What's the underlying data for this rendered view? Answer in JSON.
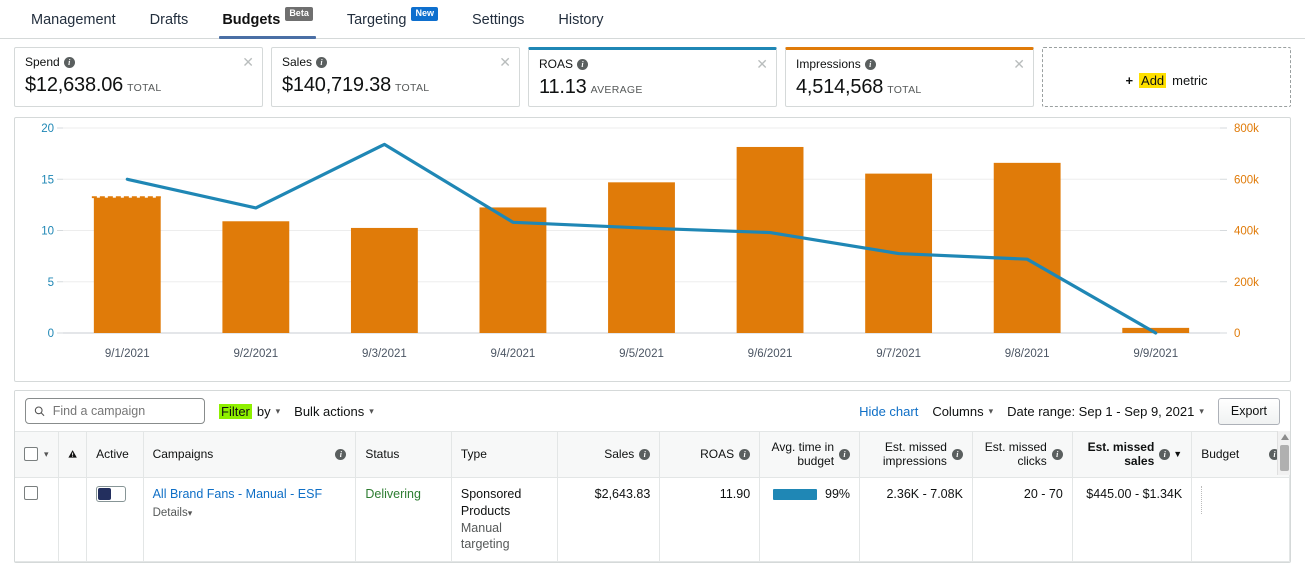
{
  "nav": {
    "tabs": [
      {
        "label": "Management",
        "active": false,
        "badge": null
      },
      {
        "label": "Drafts",
        "active": false,
        "badge": null
      },
      {
        "label": "Budgets",
        "active": true,
        "badge": "Beta",
        "badge_type": "beta"
      },
      {
        "label": "Targeting",
        "active": false,
        "badge": "New",
        "badge_type": "new"
      },
      {
        "label": "Settings",
        "active": false,
        "badge": null
      },
      {
        "label": "History",
        "active": false,
        "badge": null
      }
    ]
  },
  "metric_cards": [
    {
      "title": "Spend",
      "value": "$12,638.06",
      "unit": "TOTAL",
      "accent": "#ffffff",
      "closable": true
    },
    {
      "title": "Sales",
      "value": "$140,719.38",
      "unit": "TOTAL",
      "accent": "#ffffff",
      "closable": true
    },
    {
      "title": "ROAS",
      "value": "11.13",
      "unit": "AVERAGE",
      "accent": "#1f87b5",
      "closable": true
    },
    {
      "title": "Impressions",
      "value": "4,514,568",
      "unit": "TOTAL",
      "accent": "#e07b09",
      "closable": true
    }
  ],
  "add_metric": {
    "plus": "+",
    "highlight": "Add",
    "rest": "metric"
  },
  "chart_data": {
    "type": "bar",
    "title": "",
    "categories": [
      "9/1/2021",
      "9/2/2021",
      "9/3/2021",
      "9/4/2021",
      "9/5/2021",
      "9/6/2021",
      "9/7/2021",
      "9/8/2021",
      "9/9/2021"
    ],
    "series": [
      {
        "name": "Impressions",
        "type": "bar",
        "axis": "right",
        "color": "#e07b09",
        "values": [
          528000,
          436000,
          410000,
          490000,
          588000,
          726000,
          622000,
          664000,
          20000
        ]
      },
      {
        "name": "ROAS",
        "type": "line",
        "axis": "left",
        "color": "#1f87b5",
        "values": [
          15.0,
          12.2,
          18.4,
          10.8,
          10.25,
          9.8,
          7.75,
          7.2,
          0
        ]
      }
    ],
    "budget_cap_marker": {
      "category": "9/1/2021",
      "value": 530000,
      "color": "#e07b09",
      "style": "dashed"
    },
    "left_axis": {
      "label": "",
      "ticks": [
        0,
        5,
        10,
        15,
        20
      ],
      "tick_labels": [
        "0",
        "5",
        "10",
        "15",
        "20"
      ],
      "min": 0,
      "max": 20,
      "color": "#1f87b5"
    },
    "right_axis": {
      "label": "",
      "ticks": [
        0,
        200000,
        400000,
        600000,
        800000
      ],
      "tick_labels": [
        "0",
        "200k",
        "400k",
        "600k",
        "800k"
      ],
      "min": 0,
      "max": 800000,
      "color": "#e07b09"
    },
    "grid": true,
    "legend": "none",
    "xlabel": "",
    "ylabel": ""
  },
  "toolbar": {
    "search_placeholder": "Find a campaign",
    "search_value": "",
    "filter_highlight": "Filter",
    "filter_rest": "by",
    "bulk_actions": "Bulk actions",
    "hide_chart": "Hide chart",
    "columns": "Columns",
    "date_range": "Date range: Sep 1 - Sep 9, 2021",
    "export": "Export"
  },
  "table": {
    "columns": [
      {
        "label": "",
        "key": "select",
        "align": "left",
        "info": false,
        "sorted": false
      },
      {
        "label": "",
        "key": "warning",
        "align": "left",
        "info": false,
        "sorted": false
      },
      {
        "label": "Active",
        "key": "active",
        "align": "left",
        "info": false,
        "sorted": false
      },
      {
        "label": "Campaigns",
        "key": "campaigns",
        "align": "left",
        "info": true,
        "sorted": false
      },
      {
        "label": "Status",
        "key": "status",
        "align": "left",
        "info": false,
        "sorted": false
      },
      {
        "label": "Type",
        "key": "type",
        "align": "left",
        "info": false,
        "sorted": false
      },
      {
        "label": "Sales",
        "key": "sales",
        "align": "right",
        "info": true,
        "sorted": false
      },
      {
        "label": "ROAS",
        "key": "roas",
        "align": "right",
        "info": true,
        "sorted": false
      },
      {
        "label": "Avg. time in budget",
        "key": "avg_time",
        "align": "right",
        "info": true,
        "sorted": false
      },
      {
        "label": "Est. missed impressions",
        "key": "missed_impr",
        "align": "right",
        "info": true,
        "sorted": false
      },
      {
        "label": "Est. missed clicks",
        "key": "missed_clicks",
        "align": "right",
        "info": true,
        "sorted": false
      },
      {
        "label": "Est. missed sales",
        "key": "missed_sales",
        "align": "right",
        "info": true,
        "sorted": true
      },
      {
        "label": "Budget",
        "key": "budget",
        "align": "left",
        "info": true,
        "sorted": false
      }
    ],
    "rows": [
      {
        "campaign": "All Brand Fans - Manual - ESF",
        "details": "Details",
        "status": "Delivering",
        "type_main": "Sponsored Products",
        "type_sub": "Manual targeting",
        "sales": "$2,643.83",
        "roas": "11.90",
        "avg_time_pct": "99%",
        "avg_time_bar": 99,
        "missed_impressions": "2.36K - 7.08K",
        "missed_clicks": "20 - 70",
        "missed_sales": "$445.00 - $1.34K",
        "budget": ""
      }
    ]
  },
  "colors": {
    "bar": "#e07b09",
    "line": "#1f87b5",
    "link": "#0f6fc6",
    "tab_underline": "#4a6fa5",
    "delivering": "#2e7d32"
  }
}
